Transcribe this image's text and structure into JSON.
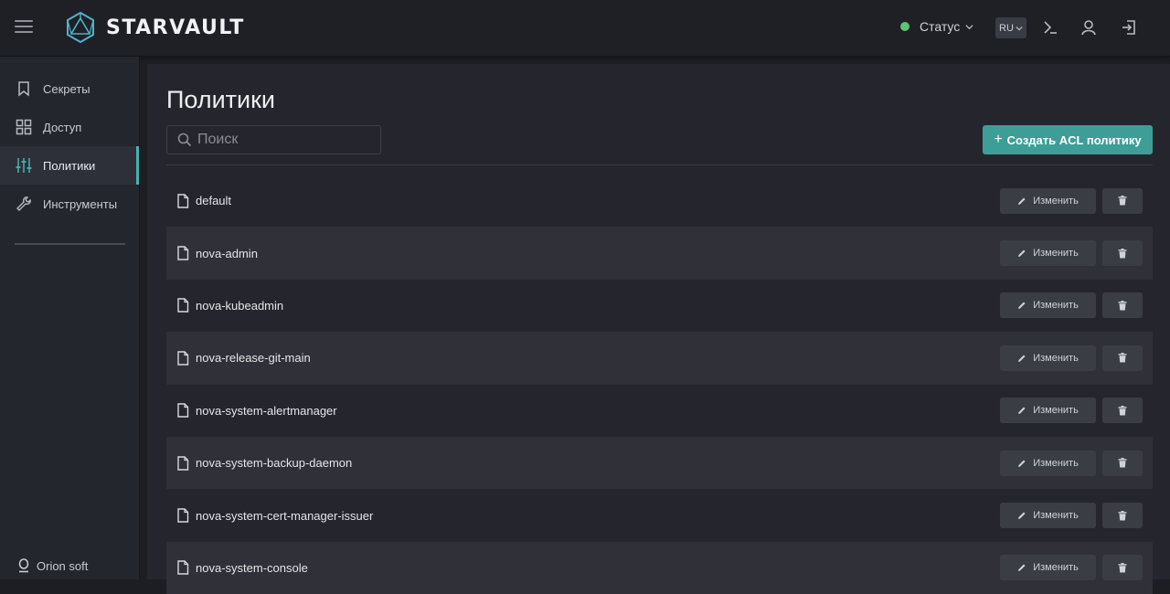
{
  "app": {
    "name": "STARVAULT"
  },
  "header": {
    "status_label": "Статус",
    "status_color": "#5fc275",
    "language": "RU",
    "icons": [
      "menu-icon",
      "logo-icon",
      "chevron-down-icon",
      "terminal-icon",
      "user-icon",
      "logout-icon"
    ]
  },
  "sidebar": {
    "items": [
      {
        "label": "Секреты",
        "icon": "bookmark-icon",
        "active": false
      },
      {
        "label": "Доступ",
        "icon": "grid-icon",
        "active": false
      },
      {
        "label": "Политики",
        "icon": "sliders-icon",
        "active": true
      },
      {
        "label": "Инструменты",
        "icon": "wrench-icon",
        "active": false
      }
    ],
    "org_label": "Orion soft"
  },
  "main": {
    "title": "Политики",
    "search_placeholder": "Поиск",
    "create_button": "Создать ACL политику",
    "create_plus": "+",
    "edit_label": "Изменить",
    "accent_color": "#3e9e97",
    "policies": [
      "default",
      "nova-admin",
      "nova-kubeadmin",
      "nova-release-git-main",
      "nova-system-alertmanager",
      "nova-system-backup-daemon",
      "nova-system-cert-manager-issuer",
      "nova-system-console"
    ]
  }
}
